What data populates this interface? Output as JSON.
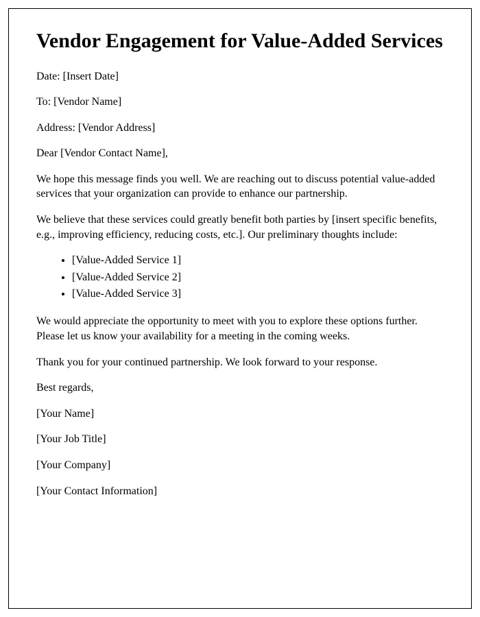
{
  "title": "Vendor Engagement for Value-Added Services",
  "date_label": "Date: ",
  "date_value": "[Insert Date]",
  "to_label": "To: ",
  "to_value": "[Vendor Name]",
  "address_label": "Address: ",
  "address_value": "[Vendor Address]",
  "salutation": "Dear [Vendor Contact Name],",
  "intro": "We hope this message finds you well. We are reaching out to discuss potential value-added services that your organization can provide to enhance our partnership.",
  "benefits": "We believe that these services could greatly benefit both parties by [insert specific benefits, e.g., improving efficiency, reducing costs, etc.]. Our preliminary thoughts include:",
  "services": [
    "[Value-Added Service 1]",
    "[Value-Added Service 2]",
    "[Value-Added Service 3]"
  ],
  "meeting": "We would appreciate the opportunity to meet with you to explore these options further. Please let us know your availability for a meeting in the coming weeks.",
  "thanks": "Thank you for your continued partnership. We look forward to your response.",
  "closing": "Best regards,",
  "signer_name": "[Your Name]",
  "signer_title": "[Your Job Title]",
  "signer_company": "[Your Company]",
  "signer_contact": "[Your Contact Information]"
}
